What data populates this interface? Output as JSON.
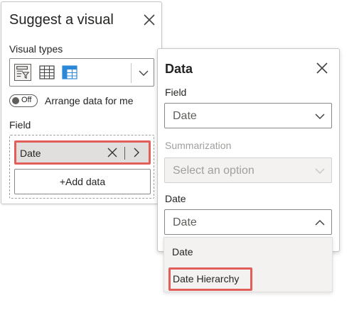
{
  "suggest_panel": {
    "title": "Suggest a visual",
    "visual_types_label": "Visual types",
    "visual_type_icons": [
      "decomposition-tree-icon",
      "table-icon",
      "matrix-icon"
    ],
    "toggle": {
      "state": "Off",
      "label": "Arrange data for me"
    },
    "field_label": "Field",
    "field_item": "Date",
    "add_data_label": "+Add data"
  },
  "data_panel": {
    "title": "Data",
    "field_label": "Field",
    "field_value": "Date",
    "summarization_label": "Summarization",
    "summarization_placeholder": "Select an option",
    "date_label": "Date",
    "date_value": "Date",
    "date_options": [
      "Date",
      "Date Hierarchy"
    ]
  },
  "colors": {
    "highlight": "#e15e5b",
    "accent_blue": "#2b88d8",
    "text": "#252423",
    "disabled_text": "#a19f9d"
  }
}
